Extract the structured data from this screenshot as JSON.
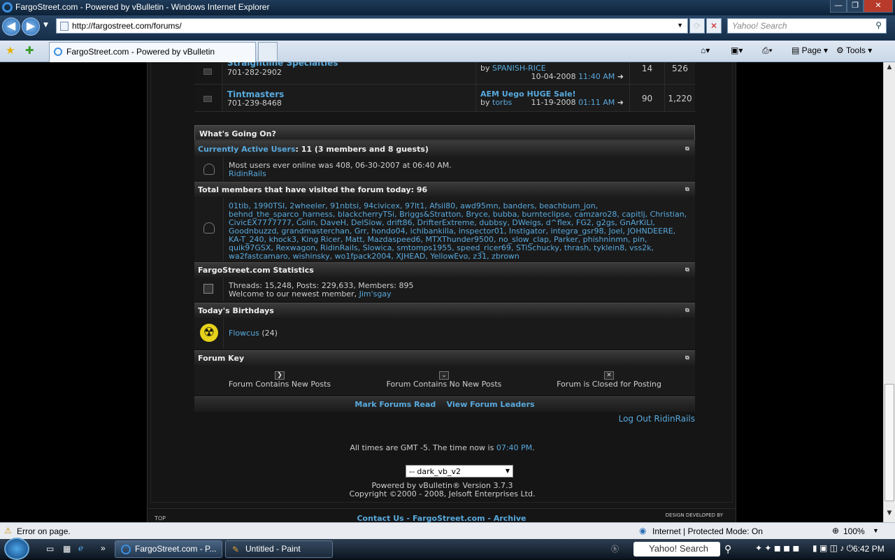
{
  "window": {
    "title": "FargoStreet.com - Powered by vBulletin - Windows Internet Explorer",
    "min": "—",
    "max": "❐",
    "close": "✕"
  },
  "addressbar": {
    "url": "http://fargostreet.com/forums/",
    "search_placeholder": "Yahoo! Search",
    "back": "◀",
    "forward": "▶"
  },
  "tabs": [
    {
      "label": "FargoStreet.com - Powered by vBulletin"
    }
  ],
  "commandbar": {
    "page": "Page",
    "tools": "Tools"
  },
  "forums": [
    {
      "name": "Straightline Specialties",
      "phone": "701-282-2902",
      "lastpost_title": "",
      "lastpost_by_label": "by",
      "lastpost_user": "SPANISH-RICE",
      "date": "10-04-2008",
      "time": "11:40 AM",
      "threads": "14",
      "posts": "526"
    },
    {
      "name": "Tintmasters",
      "phone": "701-239-8468",
      "lastpost_title": "AEM Uego HUGE Sale!",
      "lastpost_by_label": "by",
      "lastpost_user": "torbs",
      "date": "11-19-2008",
      "time": "01:11 AM",
      "threads": "90",
      "posts": "1,220"
    }
  ],
  "whats_going_on": {
    "title": "What's Going On?"
  },
  "active_users": {
    "header_link": "Currently Active Users",
    "header_rest": ": 11 (3 members and 8 guests)",
    "line1": "Most users ever online was 408, 06-30-2007 at 06:40 AM.",
    "user": "RidinRails"
  },
  "visited_today": {
    "header": "Total members that have visited the forum today: 96",
    "members": "01tib, 1990TSI, 2wheeler, 91nbtsi, 94civicex, 97lt1, Afsil80, awd95mn, banders, beachbum_jon, behnd_the_sparco_harness, blackcherryTSi, Briggs&Stratton, Bryce, bubba, burnteclipse, camzaro28, capitlj, Christian, CivicEX7777777, Colin, DaveH, DelSlow, drift86, DrifterExtreme, dubbsy, DWeigs, d^flex, FG2, g2gs, GnArKiLl, Goodnbuzzd, grandmasterchan, Grr, hondo04, ichibankilla, inspector01, Instigator, integra_gsr98, Joel, JOHNDEERE, KA-T_240, khock3, King Ricer, Matt, Mazdaspeed6, MTXThunder9500, no_slow_clap, Parker, phishninmn, pin, quik97GSX, Rexwagon, RidinRails, Slowica, smtomps1955, speed_ricer69, STiSchucky, thrash, tyklein8, vss2k, wa2fastcamaro, wishinsky, wo1fpack2004, XJHEAD, YellowEvo, z31, zbrown"
  },
  "statistics": {
    "header": "FargoStreet.com Statistics",
    "line1": "Threads: 15,248, Posts: 229,633, Members: 895",
    "line2_prefix": "Welcome to our newest member, ",
    "newest": "Jim'sgay"
  },
  "birthdays": {
    "header": "Today's Birthdays",
    "name": "Flowcus",
    "age": " (24)"
  },
  "forum_key": {
    "header": "Forum Key",
    "new": "Forum Contains New Posts",
    "nonew": "Forum Contains No New Posts",
    "closed": "Forum is Closed for Posting"
  },
  "footer_links": {
    "mark_read": "Mark Forums Read",
    "leaders": "View Forum Leaders"
  },
  "logout": "Log Out RidinRails",
  "timezone": {
    "prefix": "All times are GMT -5. The time now is ",
    "time": "07:40 PM",
    "suffix": "."
  },
  "style_select": "-- dark_vb_v2",
  "powered": "Powered by vBulletin® Version 3.7.3",
  "copyright": "Copyright ©2000 - 2008, Jelsoft Enterprises Ltd.",
  "bottom_links": "Contact Us - FargoStreet.com - Archive",
  "top_label": "TOP",
  "design_credit": "DESIGN DEVELOPED BY",
  "status": {
    "error": "Error on page.",
    "zone": "Internet | Protected Mode: On",
    "zoom": "100%"
  },
  "taskbar": {
    "task1": "FargoStreet.com - P...",
    "task2": "Untitled - Paint",
    "search": "Yahoo! Search",
    "clock": "6:42 PM"
  }
}
